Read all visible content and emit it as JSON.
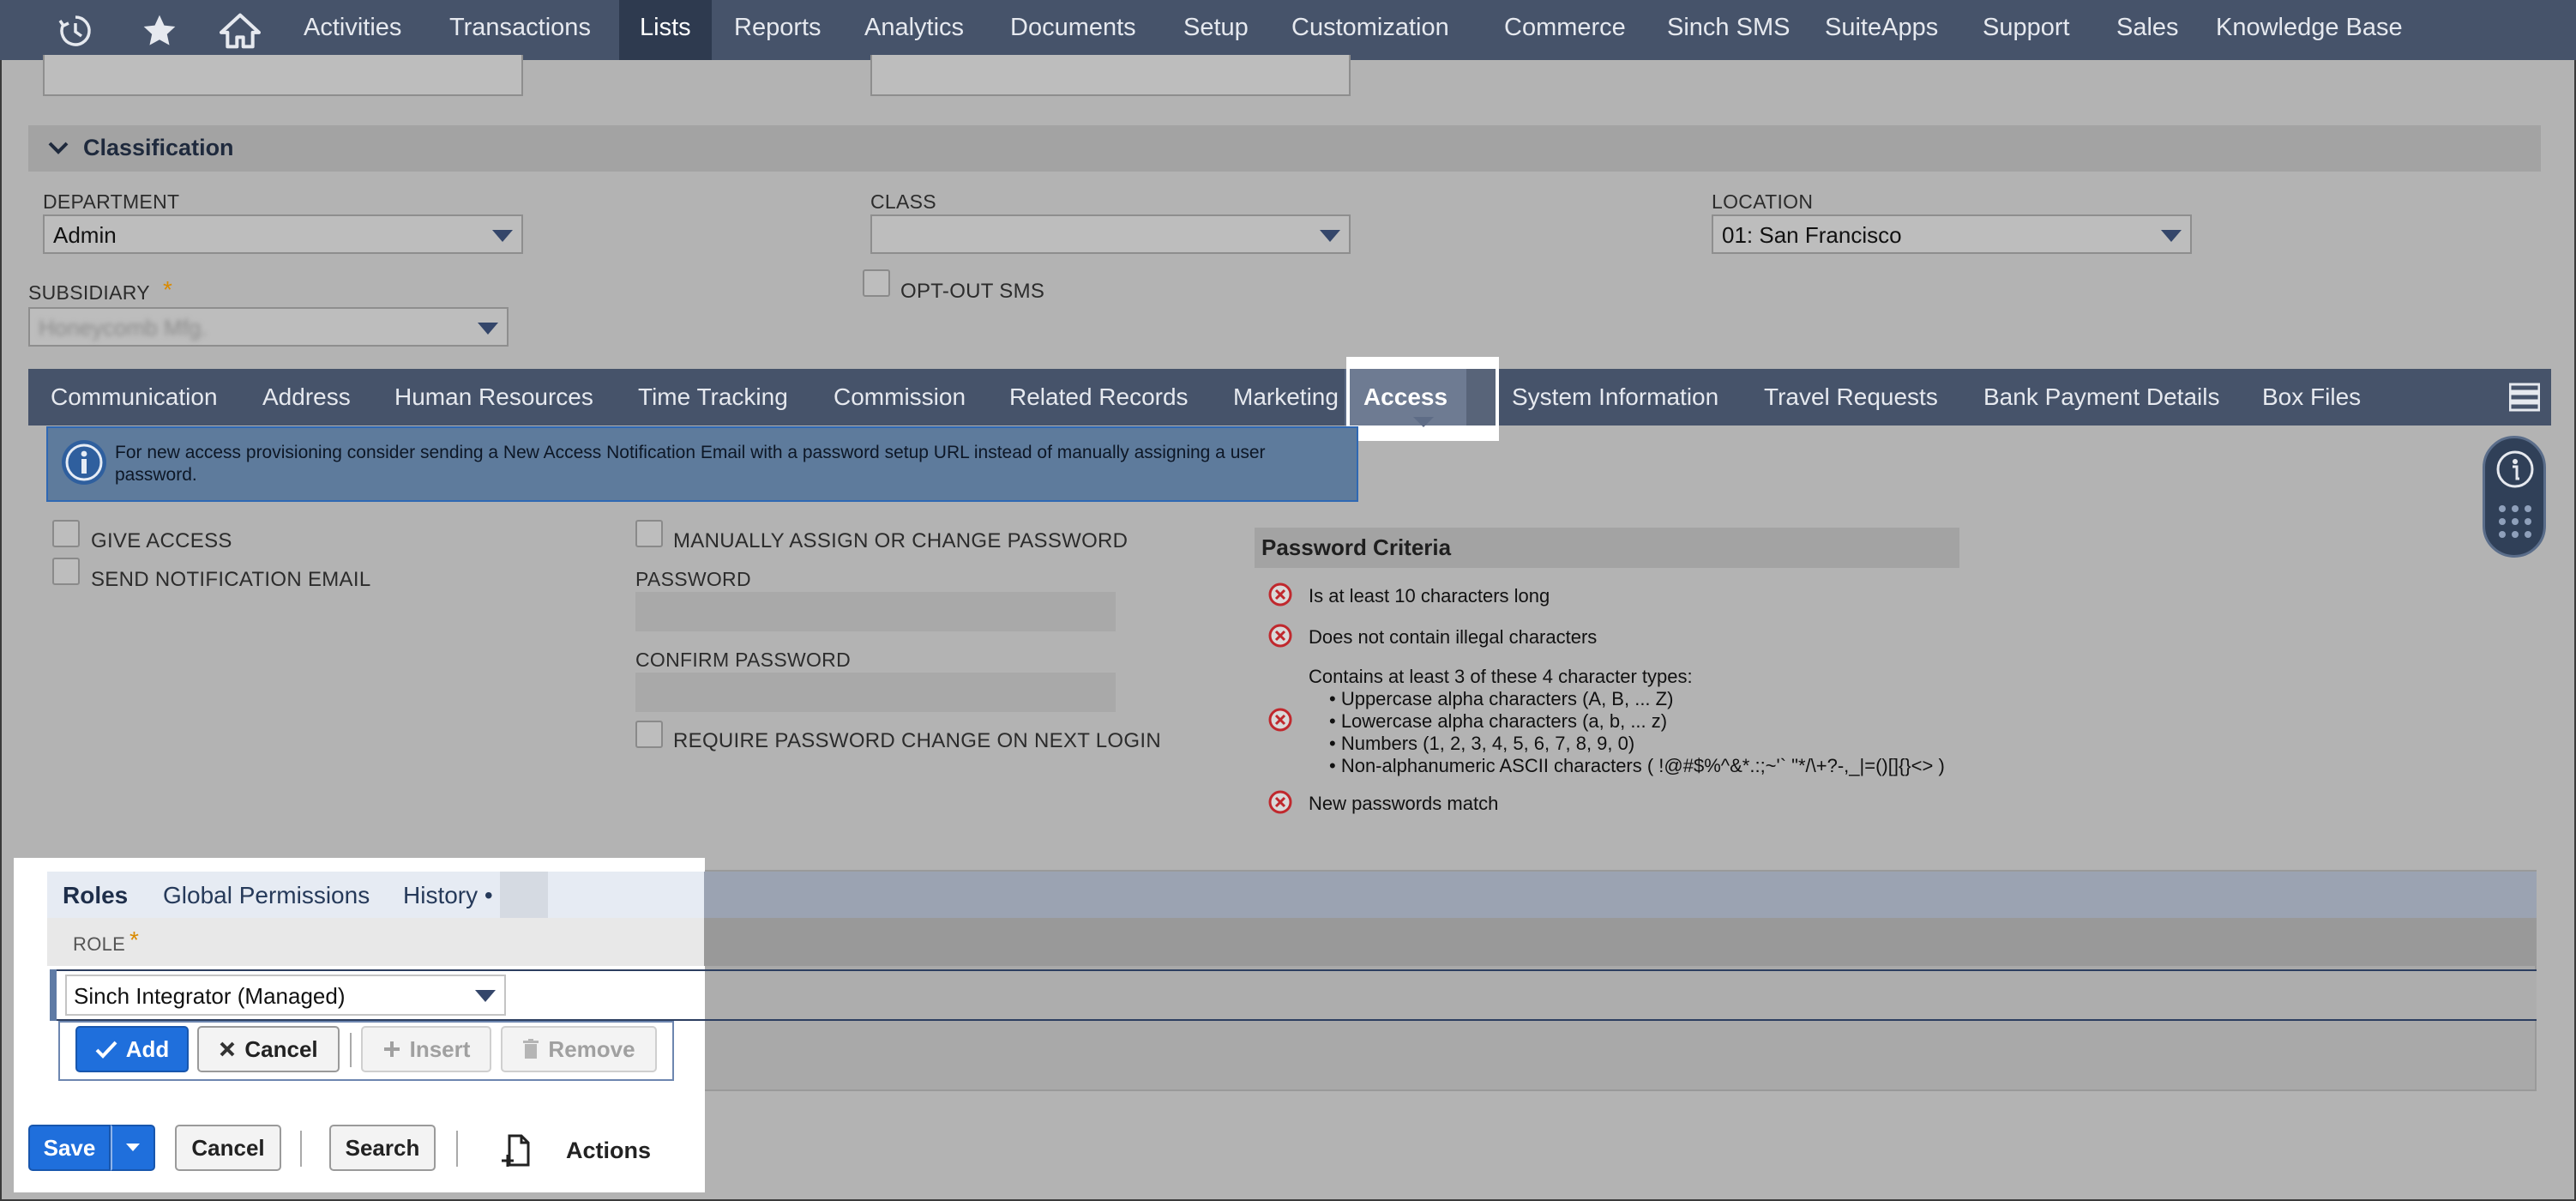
{
  "topnav": {
    "items": [
      "Activities",
      "Transactions",
      "Lists",
      "Reports",
      "Analytics",
      "Documents",
      "Setup",
      "Customization",
      "Commerce",
      "Sinch SMS",
      "SuiteApps",
      "Support",
      "Sales",
      "Knowledge Base"
    ],
    "active": "Lists",
    "icons": [
      "recent-icon",
      "star-icon",
      "home-icon"
    ]
  },
  "classification": {
    "title": "Classification",
    "department_label": "DEPARTMENT",
    "department_value": "Admin",
    "class_label": "CLASS",
    "class_value": "",
    "location_label": "LOCATION",
    "location_value": "01: San Francisco",
    "subsidiary_label": "SUBSIDIARY",
    "subsidiary_required": "*",
    "subsidiary_value": "Honeycomb Mfg.",
    "optout_label": "OPT-OUT SMS"
  },
  "subtabs": {
    "items": [
      "Communication",
      "Address",
      "Human Resources",
      "Time Tracking",
      "Commission",
      "Related Records",
      "Marketing",
      "Access",
      "System Information",
      "Travel Requests",
      "Bank Payment Details",
      "Box Files"
    ],
    "active": "Access"
  },
  "notice": {
    "text": "For new access provisioning consider sending a New Access Notification Email with a password setup URL instead of manually assigning a user password."
  },
  "access": {
    "give_access": "GIVE ACCESS",
    "send_notification": "SEND NOTIFICATION EMAIL",
    "manually_assign": "MANUALLY ASSIGN OR CHANGE PASSWORD",
    "password_label": "PASSWORD",
    "confirm_password_label": "CONFIRM PASSWORD",
    "require_change": "REQUIRE PASSWORD CHANGE ON NEXT LOGIN"
  },
  "password_criteria": {
    "title": "Password Criteria",
    "c1": "Is at least 10 characters long",
    "c2": "Does not contain illegal characters",
    "c3_intro": "Contains at least 3 of these 4 character types:",
    "c3_a": "• Uppercase alpha characters (A, B, ... Z)",
    "c3_b": "• Lowercase alpha characters (a, b, ... z)",
    "c3_c": "• Numbers (1, 2, 3, 4, 5, 6, 7, 8, 9, 0)",
    "c3_d": "• Non-alphanumeric ASCII characters ( !@#$%^&*.:;~'` \"*/\\+?-,_|=()[]{}<> )",
    "c4": "New passwords match"
  },
  "roles": {
    "tabs": [
      "Roles",
      "Global Permissions",
      "History •"
    ],
    "role_label": "ROLE",
    "role_required": "*",
    "role_value": "Sinch Integrator (Managed)",
    "add": "Add",
    "cancel": "Cancel",
    "insert": "Insert",
    "remove": "Remove"
  },
  "footer": {
    "save": "Save",
    "cancel": "Cancel",
    "search": "Search",
    "actions": "Actions"
  },
  "colors": {
    "nav_bg": "#46536a",
    "primary_button": "#1f6fdc",
    "error_icon": "#c0282d"
  }
}
